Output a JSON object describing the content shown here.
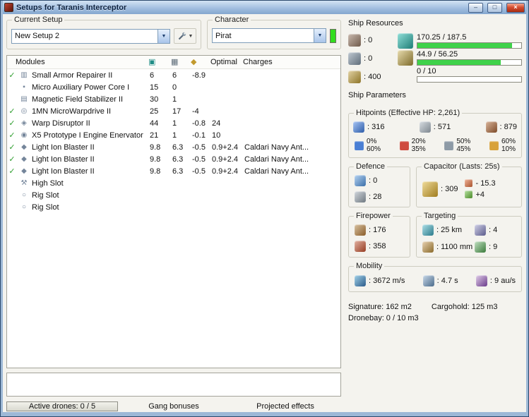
{
  "window": {
    "title": "Setups for Taranis Interceptor",
    "minimize_glyph": "–",
    "maximize_glyph": "□",
    "close_glyph": "×"
  },
  "icons": {
    "dropdown_glyph": "▼"
  },
  "setup": {
    "label": "Current Setup",
    "value": "New Setup 2"
  },
  "character": {
    "label": "Character",
    "value": "Pirat"
  },
  "modules": {
    "header": {
      "name": "Modules",
      "cpu_icon": "▣",
      "pg_icon": "▦",
      "cap_icon": "◆",
      "optimal": "Optimal",
      "charges": "Charges"
    },
    "rows": [
      {
        "check": "✓",
        "glyph": "▥",
        "name": "Small Armor Repairer II",
        "cpu": "6",
        "pg": "6",
        "cap": "-8.9",
        "optimal": "",
        "charges": ""
      },
      {
        "check": "",
        "glyph": "▪",
        "name": "Micro Auxiliary Power Core I",
        "cpu": "15",
        "pg": "0",
        "cap": "",
        "optimal": "",
        "charges": ""
      },
      {
        "check": "",
        "glyph": "▤",
        "name": "Magnetic Field Stabilizer II",
        "cpu": "30",
        "pg": "1",
        "cap": "",
        "optimal": "",
        "charges": ""
      },
      {
        "check": "✓",
        "glyph": "◎",
        "name": "1MN MicroWarpdrive II",
        "cpu": "25",
        "pg": "17",
        "cap": "-4",
        "optimal": "",
        "charges": ""
      },
      {
        "check": "✓",
        "glyph": "◈",
        "name": "Warp Disruptor II",
        "cpu": "44",
        "pg": "1",
        "cap": "-0.8",
        "optimal": "24",
        "charges": ""
      },
      {
        "check": "✓",
        "glyph": "◉",
        "name": "X5 Prototype I Engine Enervator",
        "cpu": "21",
        "pg": "1",
        "cap": "-0.1",
        "optimal": "10",
        "charges": ""
      },
      {
        "check": "✓",
        "glyph": "◆",
        "name": "Light Ion Blaster II",
        "cpu": "9.8",
        "pg": "6.3",
        "cap": "-0.5",
        "optimal": "0.9+2.4",
        "charges": "Caldari Navy Ant..."
      },
      {
        "check": "✓",
        "glyph": "◆",
        "name": "Light Ion Blaster II",
        "cpu": "9.8",
        "pg": "6.3",
        "cap": "-0.5",
        "optimal": "0.9+2.4",
        "charges": "Caldari Navy Ant..."
      },
      {
        "check": "✓",
        "glyph": "◆",
        "name": "Light Ion Blaster II",
        "cpu": "9.8",
        "pg": "6.3",
        "cap": "-0.5",
        "optimal": "0.9+2.4",
        "charges": "Caldari Navy Ant..."
      },
      {
        "check": "",
        "glyph": "⚒",
        "name": "High Slot",
        "cpu": "",
        "pg": "",
        "cap": "",
        "optimal": "",
        "charges": ""
      },
      {
        "check": "",
        "glyph": "○",
        "name": "Rig Slot",
        "cpu": "",
        "pg": "",
        "cap": "",
        "optimal": "",
        "charges": ""
      },
      {
        "check": "",
        "glyph": "○",
        "name": "Rig Slot",
        "cpu": "",
        "pg": "",
        "cap": "",
        "optimal": "",
        "charges": ""
      }
    ]
  },
  "resources": {
    "title": "Ship Resources",
    "hardpoints": [
      {
        "value": ": 0"
      },
      {
        "value": ": 0"
      },
      {
        "value": ": 400"
      }
    ],
    "bars": [
      {
        "text": "170.25 / 187.5",
        "pct": 91
      },
      {
        "text": "44.9 / 56.25",
        "pct": 80
      },
      {
        "text": "0 / 10",
        "pct": 0
      }
    ]
  },
  "parameters": {
    "title": "Ship Parameters",
    "hitpoints": {
      "title": "Hitpoints (Effective HP: 2,261)",
      "shield": ": 316",
      "armor": ": 571",
      "structure": ": 879",
      "resists": [
        {
          "top": "0%",
          "bottom": "60%",
          "color": "#4a7fd4"
        },
        {
          "top": "20%",
          "bottom": "35%",
          "color": "#cf4a3e"
        },
        {
          "top": "50%",
          "bottom": "45%",
          "color": "#8d9aa6"
        },
        {
          "top": "60%",
          "bottom": "10%",
          "color": "#d8a23a"
        }
      ]
    },
    "defence": {
      "title": "Defence",
      "shield_rate": ": 0",
      "armor_rate": ": 28"
    },
    "capacitor": {
      "title": "Capacitor (Lasts: 25s)",
      "amount": ": 309",
      "drain": "- 15.3",
      "recharge": "+4"
    },
    "firepower": {
      "title": "Firepower",
      "volley": ": 176",
      "dps": ": 358"
    },
    "targeting": {
      "title": "Targeting",
      "range": ": 25 km",
      "max_targets": ": 4",
      "scan_resolution": ": 1100 mm",
      "sensor_strength": ": 9"
    },
    "mobility": {
      "title": "Mobility",
      "velocity": ": 3672 m/s",
      "align_time": ": 4.7 s",
      "warp_speed": ": 9 au/s"
    },
    "signature": "Signature: 162 m2",
    "cargohold": "Cargohold: 125 m3",
    "dronebay": "Dronebay: 0 / 10 m3"
  },
  "bottom": {
    "active_drones": "Active drones: 0 / 5",
    "gang_bonuses": "Gang bonuses",
    "projected_effects": "Projected effects"
  },
  "colors": {
    "bar_green": "#3fd24a",
    "character_bar": "#32dd1e",
    "check_green": "#2f9e2f"
  }
}
